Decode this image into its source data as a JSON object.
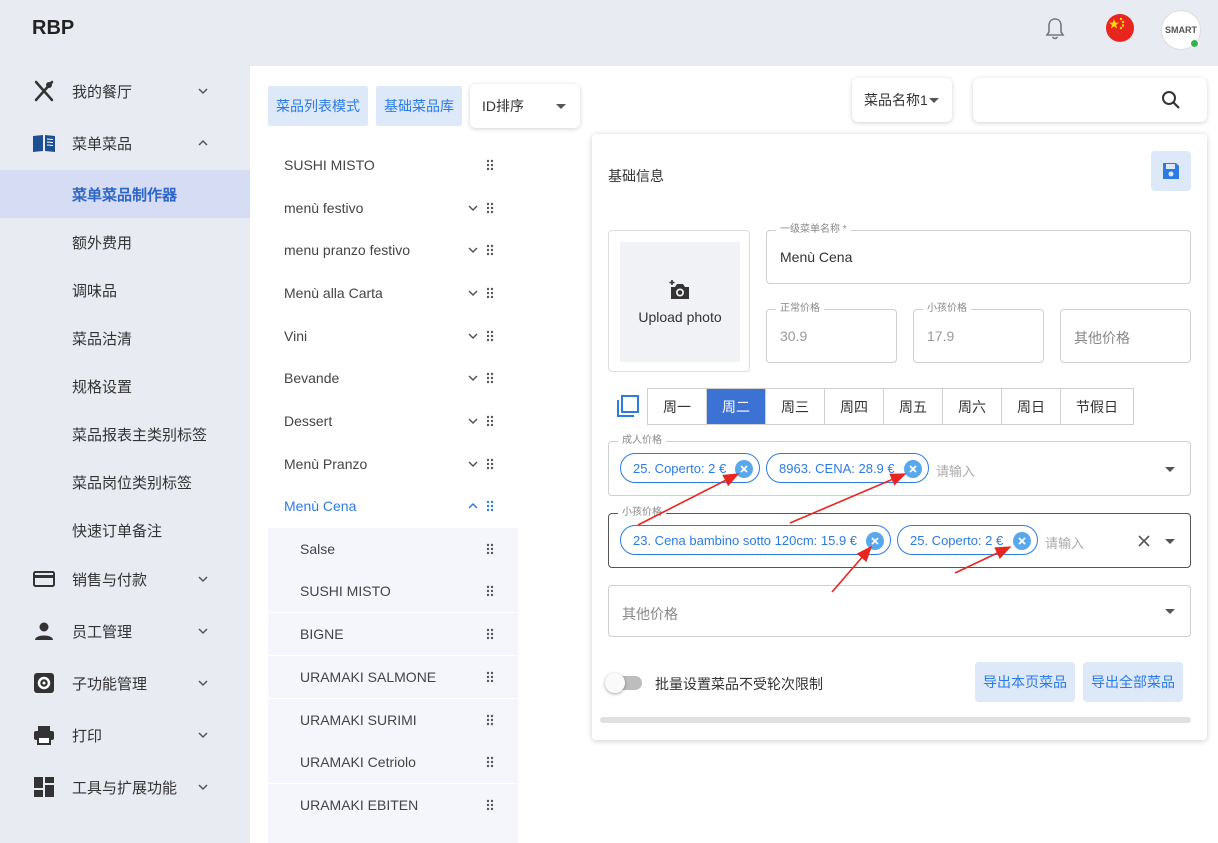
{
  "app": {
    "brand": "RBP",
    "avatar_text": "SMART"
  },
  "sidebar": {
    "items": [
      {
        "label": "我的餐厅",
        "icon": "utensils-icon"
      },
      {
        "label": "菜单菜品",
        "icon": "book-icon"
      },
      {
        "label": "销售与付款",
        "icon": "credit-card-icon"
      },
      {
        "label": "员工管理",
        "icon": "person-icon"
      },
      {
        "label": "子功能管理",
        "icon": "gear-box-icon"
      },
      {
        "label": "打印",
        "icon": "printer-icon"
      },
      {
        "label": "工具与扩展功能",
        "icon": "dashboard-icon"
      }
    ],
    "sub_items": [
      "菜单菜品制作器",
      "额外费用",
      "调味品",
      "菜品沽清",
      "规格设置",
      "菜品报表主类别标签",
      "菜品岗位类别标签",
      "快速订单备注"
    ]
  },
  "toolbar": {
    "list_mode": "菜品列表模式",
    "base_library": "基础菜品库",
    "sort_value": "ID排序",
    "field_select": "菜品名称1",
    "search_placeholder": ""
  },
  "menu_list": {
    "top": [
      "SUSHI MISTO",
      "menù festivo",
      "menu pranzo festivo",
      "Menù alla Carta",
      "Vini",
      "Bevande",
      "Dessert",
      "Menù Pranzo",
      "Menù Cena"
    ],
    "children": [
      "Salse",
      "SUSHI MISTO",
      "BIGNE",
      "URAMAKI SALMONE",
      "URAMAKI SURIMI",
      "URAMAKI Cetriolo",
      "URAMAKI EBITEN"
    ]
  },
  "form": {
    "title": "基础信息",
    "upload_label": "Upload photo",
    "menu_name_legend": "一级菜单名称 *",
    "menu_name_value": "Menù Cena",
    "normal_price_legend": "正常价格",
    "normal_price_value": "30.9",
    "child_price_legend": "小孩价格",
    "child_price_value": "17.9",
    "other_price_placeholder": "其他价格",
    "days": [
      "周一",
      "周二",
      "周三",
      "周四",
      "周五",
      "周六",
      "周日",
      "节假日"
    ],
    "active_day": "周二",
    "adult_legend": "成人价格",
    "adult_tags": [
      "25. Coperto: 2 €",
      "8963. CENA: 28.9 €"
    ],
    "child_legend": "小孩价格",
    "child_tags": [
      "23. Cena bambino sotto 120cm: 15.9 €",
      "25. Coperto: 2 €"
    ],
    "input_placeholder": "请输入",
    "other_placeholder": "其他价格",
    "toggle_label": "批量设置菜品不受轮次限制",
    "export_page": "导出本页菜品",
    "export_all": "导出全部菜品"
  },
  "colors": {
    "accent": "#2c7be5",
    "active_tab": "#3b72d4",
    "annotation": "#e8251e"
  }
}
